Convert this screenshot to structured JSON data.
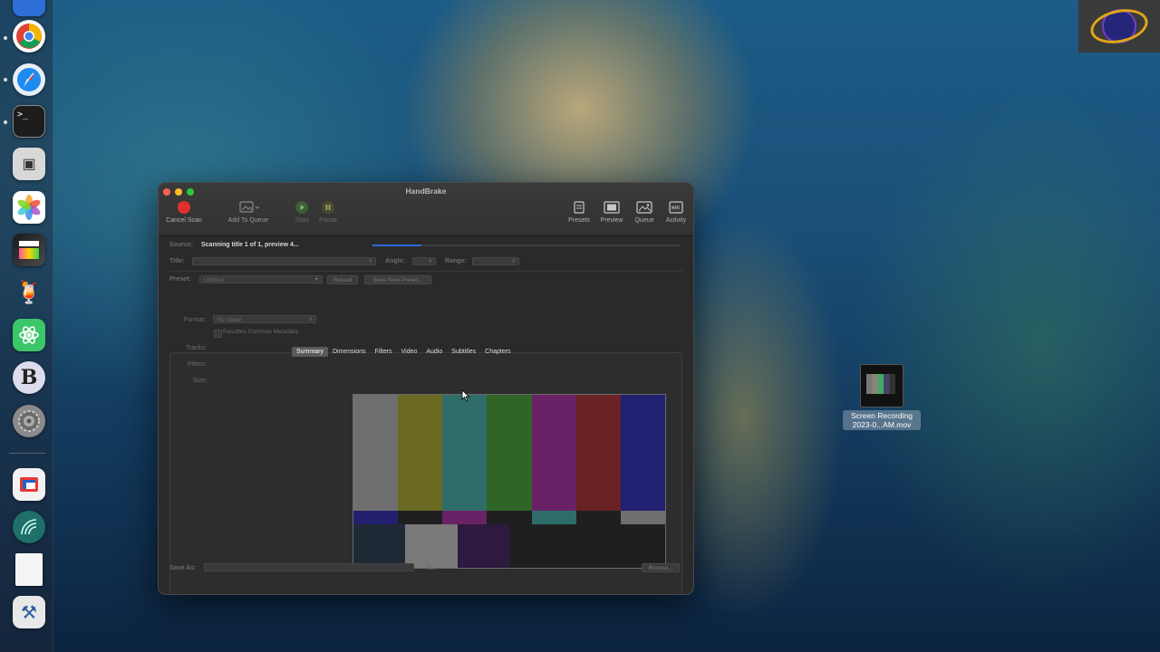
{
  "window": {
    "title": "HandBrake",
    "traffic_colors": [
      "#fe5f57",
      "#febc2e",
      "#28c840"
    ]
  },
  "toolbar": {
    "cancel_scan": "Cancel Scan",
    "add_to_queue": "Add To Queue",
    "start": "Start",
    "pause": "Pause",
    "presets": "Presets",
    "preview": "Preview",
    "queue": "Queue",
    "activity": "Activity",
    "accent_red": "#e0302e",
    "accent_green": "#4a8a3e"
  },
  "source": {
    "label": "Source:",
    "status": "Scanning title 1 of 1, preview 4...",
    "progress": 0.16
  },
  "title_row": {
    "title_label": "Title:",
    "angle_label": "Angle:",
    "range_label": "Range:"
  },
  "preset_row": {
    "preset_label": "Preset:",
    "preset_value": "Untitled",
    "reload": "Reload",
    "save_new": "Save New Preset..."
  },
  "tabs": [
    "Summary",
    "Dimensions",
    "Filters",
    "Video",
    "Audio",
    "Subtitles",
    "Chapters"
  ],
  "summary": {
    "format_label": "Format:",
    "format_value": "No Value",
    "passthru": "Passthru Common Metadata",
    "tracks_label": "Tracks:",
    "filters_label": "Filters:",
    "size_label": "Size:"
  },
  "preview_bars": {
    "top": [
      "#6f6f6f",
      "#6b6a25",
      "#2f6d6a",
      "#2f6526",
      "#6a2266",
      "#6a2224",
      "#222070"
    ],
    "mid": [
      "#22206e",
      "#1f1f1f",
      "#6a2266",
      "#1f1f1f",
      "#2f6d6a",
      "#1f1f1f",
      "#6f6f6f"
    ],
    "bottom": [
      "#1e2936",
      "#7a7a7a",
      "#2d1a3e",
      "#1f1f1f",
      "#1f1f1f",
      "#1f1f1f"
    ]
  },
  "save": {
    "save_as_label": "Save As:",
    "to_label": "To:",
    "browse": "Browse..."
  },
  "desktop_file": {
    "line1": "Screen Recording",
    "line2": "2023-0...AM.mov"
  }
}
